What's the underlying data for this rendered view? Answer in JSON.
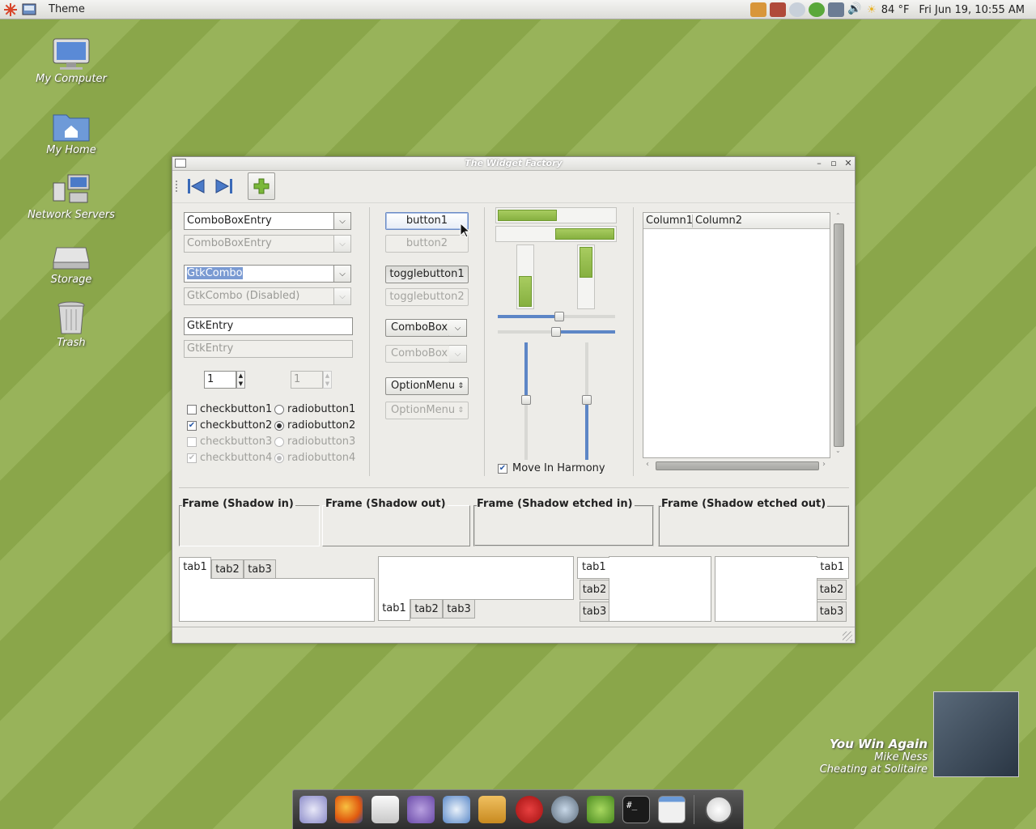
{
  "panel": {
    "menu_label": "Theme",
    "weather": "84 °F",
    "clock": "Fri Jun 19, 10:55 AM"
  },
  "desktop": {
    "icons": [
      "My Computer",
      "My Home",
      "Network Servers",
      "Storage",
      "Trash"
    ]
  },
  "window": {
    "title": "The Widget Factory",
    "combos": {
      "comboboxentry": "ComboBoxEntry",
      "comboboxentry_disabled": "ComboBoxEntry",
      "gtkcombo": "GtkCombo",
      "gtkcombo_disabled": "GtkCombo (Disabled)",
      "gtkentry": "GtkEntry",
      "gtkentry_disabled": "GtkEntry",
      "spin_value": "1",
      "spin_disabled_value": "1"
    },
    "checks": [
      {
        "label": "checkbutton1",
        "checked": false,
        "disabled": false
      },
      {
        "label": "checkbutton2",
        "checked": true,
        "disabled": false
      },
      {
        "label": "checkbutton3",
        "checked": false,
        "disabled": true
      },
      {
        "label": "checkbutton4",
        "checked": true,
        "disabled": true
      }
    ],
    "radios": [
      {
        "label": "radiobutton1",
        "checked": false,
        "disabled": false
      },
      {
        "label": "radiobutton2",
        "checked": true,
        "disabled": false
      },
      {
        "label": "radiobutton3",
        "checked": false,
        "disabled": true
      },
      {
        "label": "radiobutton4",
        "checked": true,
        "disabled": true
      }
    ],
    "buttons": {
      "button1": "button1",
      "button2": "button2",
      "toggle1": "togglebutton1",
      "toggle2": "togglebutton2",
      "combobox": "ComboBox",
      "combobox_disabled": "ComboBox",
      "optionmenu": "OptionMenu",
      "optionmenu_disabled": "OptionMenu"
    },
    "progress": {
      "h1": 0.5,
      "h2_inverted": 0.5,
      "v1_inverted": 0.5,
      "v2": 0.5
    },
    "move_in_harmony": "Move In Harmony",
    "list": {
      "columns": [
        "Column1",
        "Column2"
      ]
    },
    "frames": [
      "Frame (Shadow in)",
      "Frame (Shadow out)",
      "Frame (Shadow etched in)",
      "Frame (Shadow etched out)"
    ],
    "tabs": [
      "tab1",
      "tab2",
      "tab3"
    ]
  },
  "music": {
    "title": "You Win Again",
    "artist": "Mike Ness",
    "album": "Cheating at Solitaire"
  }
}
